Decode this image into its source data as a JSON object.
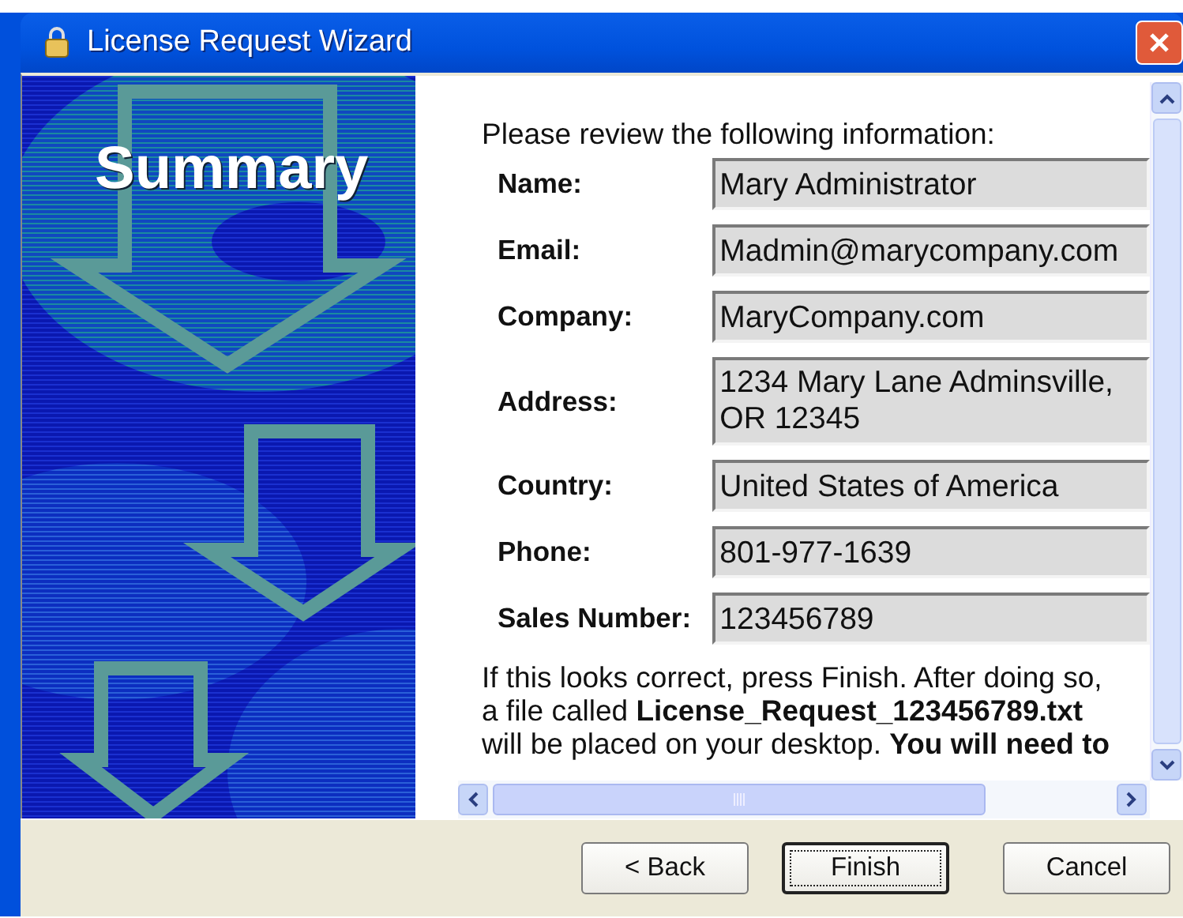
{
  "window": {
    "title": "License Request Wizard"
  },
  "banner": {
    "title": "Summary"
  },
  "intro": "Please review the following information:",
  "fields": [
    {
      "label": "Name:",
      "value": "Mary Administrator",
      "kind": "single"
    },
    {
      "label": "Email:",
      "value": "Madmin@marycompany.com",
      "kind": "single"
    },
    {
      "label": "Company:",
      "value": "MaryCompany.com",
      "kind": "single"
    },
    {
      "label": "Address:",
      "value": "1234 Mary Lane Adminsville, OR 12345",
      "kind": "multi"
    },
    {
      "label": "Country:",
      "value": "United States of America",
      "kind": "single"
    },
    {
      "label": "Phone:",
      "value": "801-977-1639",
      "kind": "single"
    },
    {
      "label": "Sales Number:",
      "value": "123456789",
      "kind": "single"
    }
  ],
  "message": "If this looks correct, press Finish. After doing so, a file called **License_Request_123456789.txt** will be placed on your desktop. **You will need to**",
  "buttons": [
    {
      "label": "< Back",
      "focused": false
    },
    {
      "label": "Finish",
      "focused": true
    },
    {
      "label": "Cancel",
      "focused": false
    }
  ]
}
